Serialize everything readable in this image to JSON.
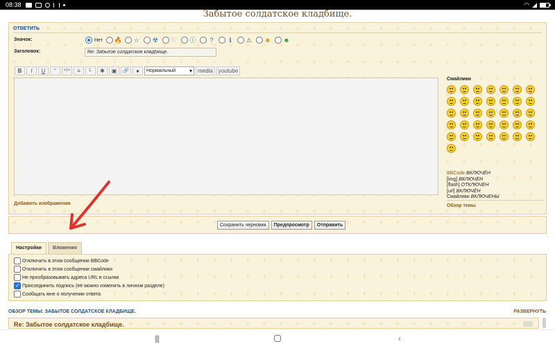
{
  "status_bar": {
    "time": "08:38",
    "icons": [
      "youtube-icon",
      "gallery-icon",
      "search-icon",
      "nfc-icon",
      "dot-icon",
      "wifi-icon",
      "signal-icon",
      "battery-icon"
    ]
  },
  "page_title": "Забытое солдатское кладбище.",
  "reply_form": {
    "header": "ОТВЕТИТЬ",
    "icon_label": "Значок:",
    "icon_none_label": "Нет",
    "icon_options": [
      "fire",
      "star",
      "radioactive",
      "heart",
      "exclaim",
      "question",
      "info",
      "warning",
      "lol",
      "mad"
    ],
    "subject_label": "Заголовок:",
    "subject_value": "Re: Забытое солдатское кладбище.",
    "toolbar": {
      "bold": "B",
      "italic": "I",
      "underline": "U",
      "quote": "“",
      "code": "</>",
      "list": "≡",
      "list_ordered": "1.",
      "list_item": "✱",
      "image": "▣",
      "link": "🔗",
      "color": "●",
      "font_size_value": "Нормальный",
      "media_label": "media",
      "youtube_label": "youtube"
    },
    "smilies_title": "Смайлики",
    "smilies_count": 36,
    "bbcode_info": [
      {
        "text": "BBCode",
        "status": "ВКЛЮЧЁН"
      },
      {
        "text": "[img]",
        "status": "ВКЛЮЧЁН"
      },
      {
        "text": "[flash]",
        "status": "ОТКЛЮЧЕН"
      },
      {
        "text": "[url]",
        "status": "ВКЛЮЧЁН"
      },
      {
        "text": "Смайлики",
        "status": "ВКЛЮЧЕНЫ"
      }
    ],
    "add_images_label": "Добавить изображения",
    "topic_review_label": "Обзор темы"
  },
  "buttons": {
    "save_draft": "Сохранить черновик",
    "preview": "Предпросмотр",
    "submit": "Отправить"
  },
  "tabs": [
    {
      "label": "Настройки",
      "active": true
    },
    {
      "label": "Вложения",
      "active": false
    }
  ],
  "options": [
    {
      "label": "Отключить в этом сообщении BBCode",
      "checked": false
    },
    {
      "label": "Отключить в этом сообщении смайлики",
      "checked": false
    },
    {
      "label": "Не преобразовывать адреса URL в ссылки",
      "checked": false
    },
    {
      "label": "Присоединить подпись (её можно изменять в личном разделе)",
      "checked": true
    },
    {
      "label": "Сообщать мне о получении ответа",
      "checked": false
    }
  ],
  "review": {
    "header": "ОБЗОР ТЕМЫ: ЗАБЫТОЕ СОЛДАТСКОЕ КЛАДБИЩЕ.",
    "expand_label": "РАЗВЕРНУТЬ",
    "post_title": "Re: Забытое солдатское кладбище."
  },
  "nav_bar": {
    "recent": "|||",
    "back": "‹"
  },
  "colors": {
    "panel_bg": "#faf3dc",
    "link_brown": "#8a5a1a",
    "header_blue": "#1b4f8a",
    "annotation_red": "#e0332f"
  }
}
